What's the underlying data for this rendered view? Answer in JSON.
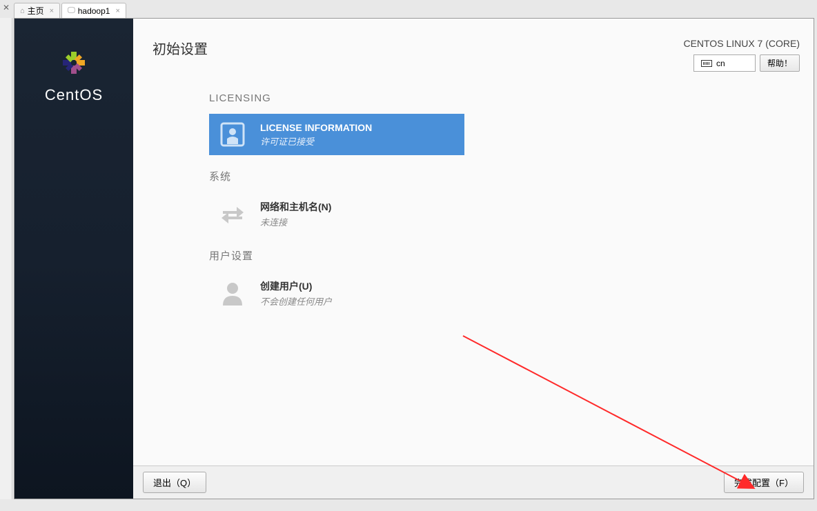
{
  "tabs": [
    {
      "label": "主页",
      "icon": "home"
    },
    {
      "label": "hadoop1",
      "icon": "vm"
    }
  ],
  "sidebar": {
    "brand": "CentOS"
  },
  "header": {
    "title": "初始设置",
    "distro": "CENTOS LINUX 7 (CORE)",
    "keyboard": "cn",
    "help": "帮助！"
  },
  "sections": {
    "licensing": {
      "label": "LICENSING",
      "spoke": {
        "title": "LICENSE INFORMATION",
        "status": "许可证已接受"
      }
    },
    "system": {
      "label": "系统",
      "spoke": {
        "title": "网络和主机名(N)",
        "status": "未连接"
      }
    },
    "user": {
      "label": "用户设置",
      "spoke": {
        "title": "创建用户(U)",
        "status": "不会创建任何用户"
      }
    }
  },
  "footer": {
    "quit": "退出（Q）",
    "finish": "完成配置（F）"
  },
  "statusbar": {
    "left": "",
    "watermark": ""
  }
}
